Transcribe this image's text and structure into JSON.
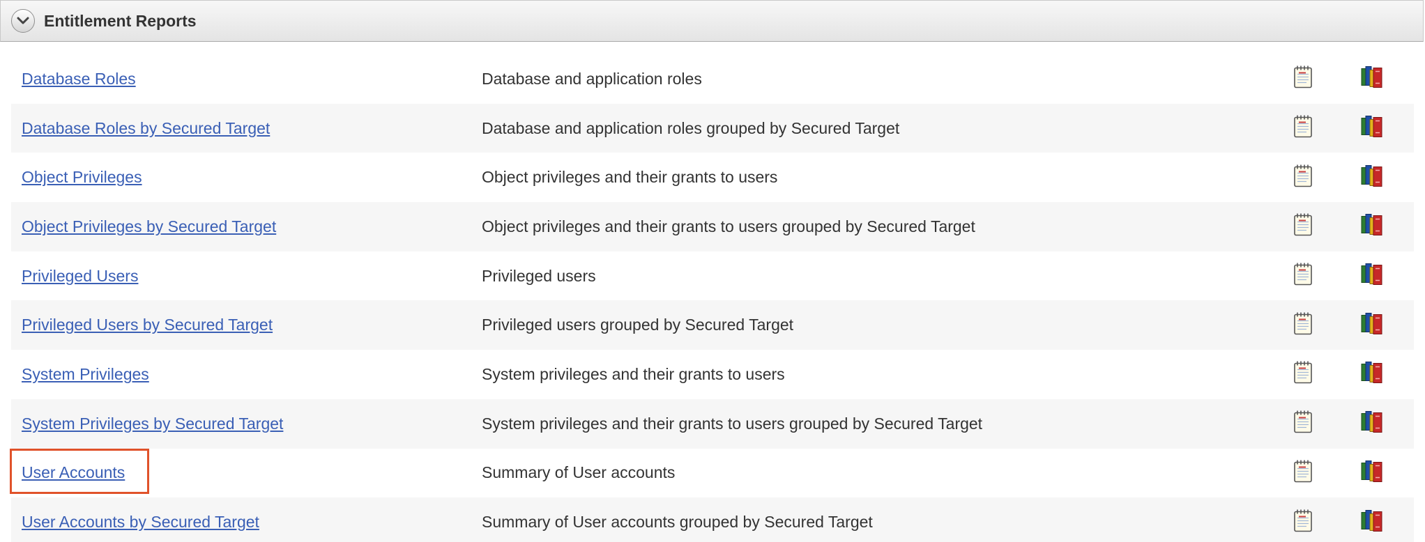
{
  "section": {
    "title": "Entitlement Reports",
    "collapse_icon": "chevron-down-icon"
  },
  "reports": [
    {
      "label": "Database Roles",
      "description": "Database and application roles"
    },
    {
      "label": "Database Roles by Secured Target",
      "description": "Database and application roles grouped by Secured Target"
    },
    {
      "label": "Object Privileges",
      "description": "Object privileges and their grants to users"
    },
    {
      "label": "Object Privileges by Secured Target",
      "description": "Object privileges and their grants to users grouped by Secured Target"
    },
    {
      "label": "Privileged Users",
      "description": "Privileged users"
    },
    {
      "label": "Privileged Users by Secured Target",
      "description": "Privileged users grouped by Secured Target"
    },
    {
      "label": "System Privileges",
      "description": "System privileges and their grants to users"
    },
    {
      "label": "System Privileges by Secured Target",
      "description": "System privileges and their grants to users grouped by Secured Target"
    },
    {
      "label": "User Accounts",
      "description": "Summary of User accounts"
    },
    {
      "label": "User Accounts by Secured Target",
      "description": "Summary of User accounts grouped by Secured Target"
    }
  ],
  "row_icons": [
    "notepad-icon",
    "books-icon"
  ],
  "highlighted_report": "User Accounts",
  "colors": {
    "link": "#3a5fb5",
    "highlight": "#e0522a",
    "alt_row": "#f6f6f6"
  }
}
